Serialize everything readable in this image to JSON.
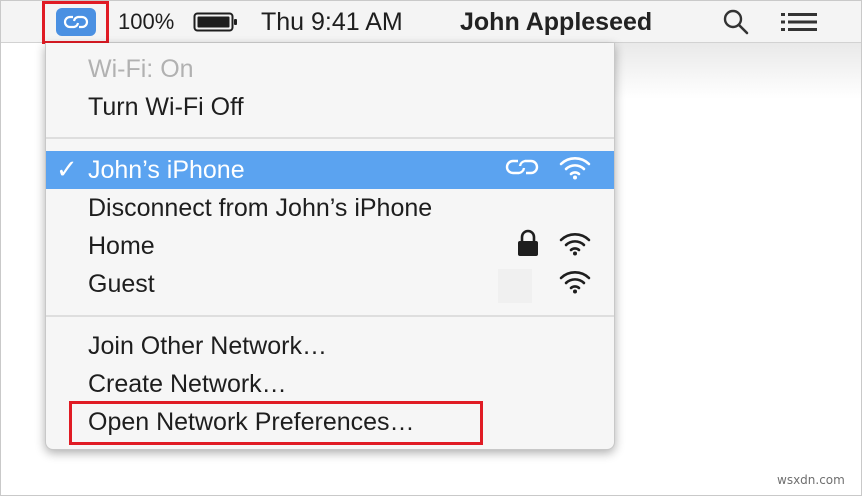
{
  "menubar": {
    "hotspot_icon": "personal-hotspot-icon",
    "battery_percent": "100%",
    "battery_icon": "battery-full-icon",
    "clock": "Thu 9:41 AM",
    "user_name": "John Appleseed",
    "search_icon": "magnifier-icon",
    "list_icon": "notification-list-icon"
  },
  "wifi_menu": {
    "status": "Wi-Fi: On",
    "toggle": "Turn Wi-Fi Off",
    "networks": [
      {
        "name": "John’s iPhone",
        "selected": true,
        "icons": [
          "hotspot-link-icon",
          "wifi-icon"
        ]
      },
      {
        "name": "Disconnect from John’s iPhone",
        "icons": []
      },
      {
        "name": "Home",
        "icons": [
          "lock-icon",
          "wifi-icon"
        ]
      },
      {
        "name": "Guest",
        "icons": [
          "wifi-icon"
        ]
      }
    ],
    "actions": {
      "join_other": "Join Other Network…",
      "create": "Create Network…",
      "preferences": "Open Network Preferences…"
    }
  },
  "colors": {
    "selection": "#5ba3f0",
    "hotspot_icon_bg": "#4a90e2",
    "highlight_box": "#e01b24"
  },
  "watermark": "wsxdn.com"
}
